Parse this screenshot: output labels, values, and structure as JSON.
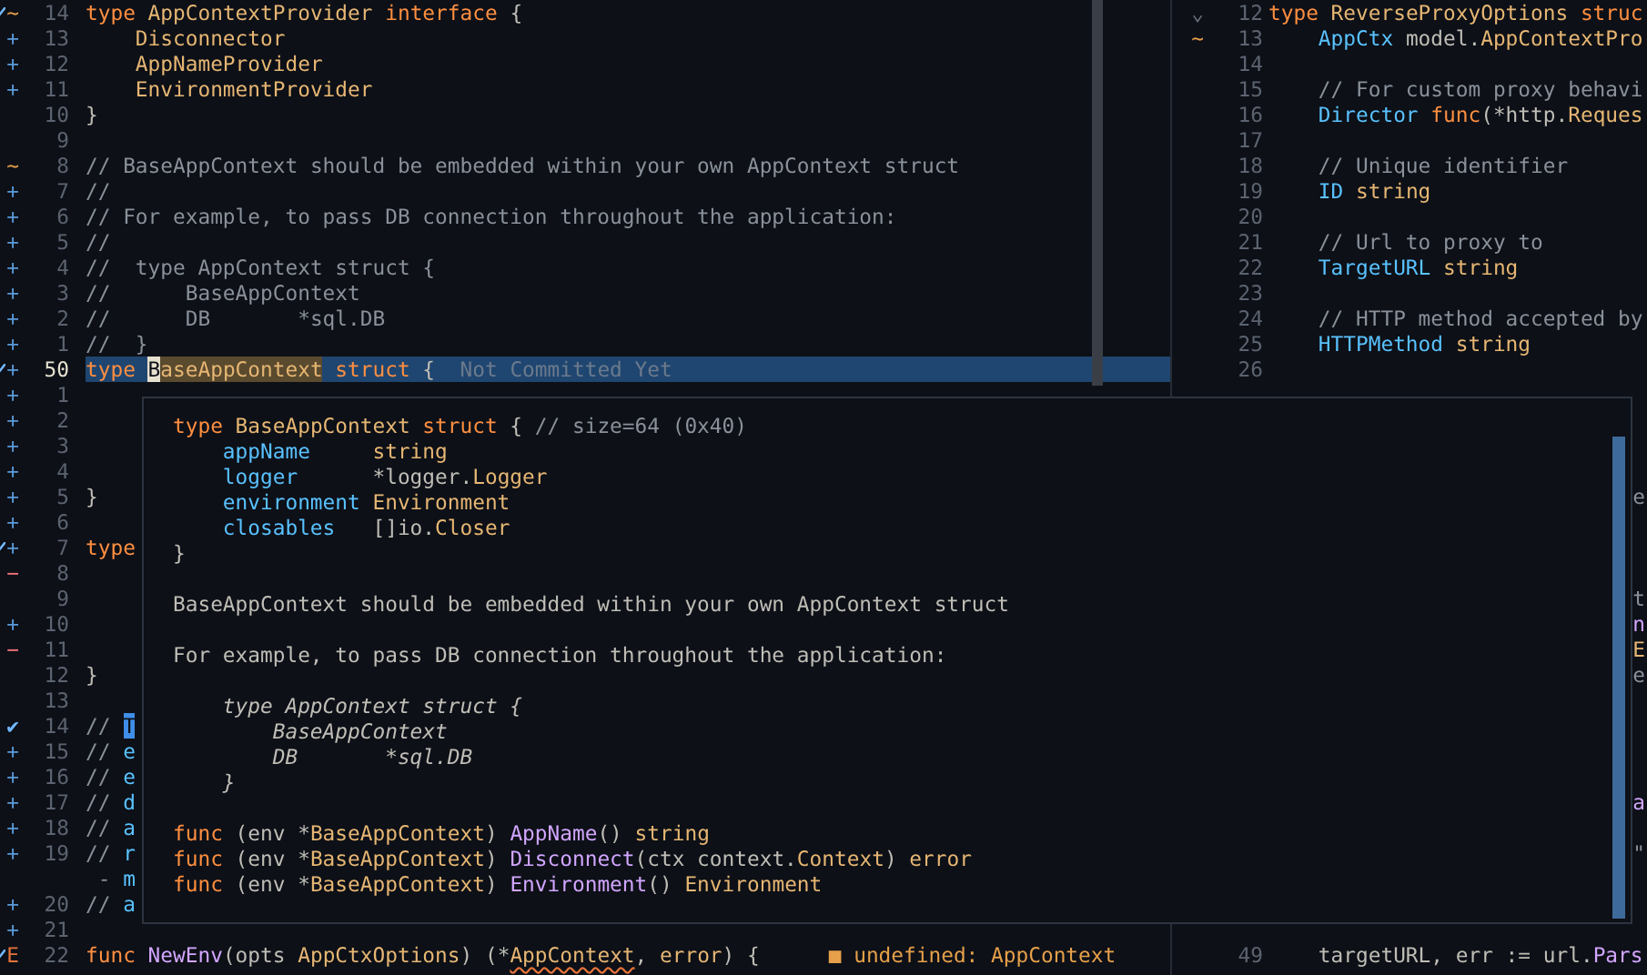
{
  "left_pane": {
    "lines": [
      {
        "sign": {
          "text": "~",
          "kind": "changed"
        },
        "marked": true,
        "number": "14",
        "tokens": [
          {
            "text": "type ",
            "kind": "keyword"
          },
          {
            "text": "AppContextProvider ",
            "kind": "type"
          },
          {
            "text": "interface",
            "kind": "keyword"
          },
          {
            "text": " {",
            "kind": "plain"
          }
        ]
      },
      {
        "sign": {
          "text": "+",
          "kind": "added"
        },
        "number": "13",
        "tokens": [
          {
            "text": "    Disconnector",
            "kind": "type"
          }
        ]
      },
      {
        "sign": {
          "text": "+",
          "kind": "added"
        },
        "number": "12",
        "tokens": [
          {
            "text": "    AppNameProvider",
            "kind": "type"
          }
        ]
      },
      {
        "sign": {
          "text": "+",
          "kind": "added"
        },
        "number": "11",
        "tokens": [
          {
            "text": "    EnvironmentProvider",
            "kind": "type"
          }
        ]
      },
      {
        "number": "10",
        "tokens": [
          {
            "text": "}",
            "kind": "plain"
          }
        ]
      },
      {
        "number": "9"
      },
      {
        "sign": {
          "text": "~",
          "kind": "changed"
        },
        "number": "8",
        "tokens": [
          {
            "text": "// BaseAppContext should be embedded within your own AppContext struct",
            "kind": "comment"
          }
        ]
      },
      {
        "sign": {
          "text": "+",
          "kind": "added"
        },
        "number": "7",
        "tokens": [
          {
            "text": "//",
            "kind": "comment"
          }
        ]
      },
      {
        "sign": {
          "text": "+",
          "kind": "added"
        },
        "number": "6",
        "tokens": [
          {
            "text": "// For example, to pass DB connection throughout the application:",
            "kind": "comment"
          }
        ]
      },
      {
        "sign": {
          "text": "+",
          "kind": "added"
        },
        "number": "5",
        "tokens": [
          {
            "text": "//",
            "kind": "comment"
          }
        ]
      },
      {
        "sign": {
          "text": "+",
          "kind": "added"
        },
        "number": "4",
        "tokens": [
          {
            "text": "//  type AppContext struct {",
            "kind": "comment"
          }
        ]
      },
      {
        "sign": {
          "text": "+",
          "kind": "added"
        },
        "number": "3",
        "tokens": [
          {
            "text": "//      BaseAppContext",
            "kind": "comment"
          }
        ]
      },
      {
        "sign": {
          "text": "+",
          "kind": "added"
        },
        "number": "2",
        "tokens": [
          {
            "text": "//      DB       *sql.DB",
            "kind": "comment"
          }
        ]
      },
      {
        "sign": {
          "text": "+",
          "kind": "added"
        },
        "number": "1",
        "tokens": [
          {
            "text": "//  }",
            "kind": "comment"
          }
        ]
      },
      {
        "sign": {
          "text": "+",
          "kind": "added"
        },
        "marked": true,
        "current": true,
        "number": "50",
        "tokens": [
          {
            "text": "type ",
            "kind": "keyword"
          },
          {
            "text": "B",
            "kind": "cursor"
          },
          {
            "text": "aseAppContext",
            "kind": "reference"
          },
          {
            "text": " struct",
            "kind": "keyword"
          },
          {
            "text": " {",
            "kind": "plain"
          },
          {
            "text": "  Not Committed Yet",
            "kind": "blame"
          }
        ]
      },
      {
        "sign": {
          "text": "+",
          "kind": "added"
        },
        "number": "1"
      },
      {
        "sign": {
          "text": "+",
          "kind": "added"
        },
        "number": "2"
      },
      {
        "sign": {
          "text": "+",
          "kind": "added"
        },
        "number": "3"
      },
      {
        "sign": {
          "text": "+",
          "kind": "added"
        },
        "number": "4"
      },
      {
        "sign": {
          "text": "+",
          "kind": "added"
        },
        "number": "5",
        "tokens": [
          {
            "text": "}",
            "kind": "plain"
          }
        ]
      },
      {
        "sign": {
          "text": "+",
          "kind": "added"
        },
        "number": "6"
      },
      {
        "sign": {
          "text": "+",
          "kind": "added"
        },
        "marked": true,
        "number": "7",
        "tokens": [
          {
            "text": "type",
            "kind": "keyword"
          }
        ]
      },
      {
        "sign": {
          "text": "−",
          "kind": "removed"
        },
        "number": "8"
      },
      {
        "number": "9"
      },
      {
        "sign": {
          "text": "+",
          "kind": "added"
        },
        "number": "10"
      },
      {
        "sign": {
          "text": "−",
          "kind": "removed"
        },
        "number": "11"
      },
      {
        "number": "12",
        "tokens": [
          {
            "text": "}",
            "kind": "plain"
          }
        ]
      },
      {
        "number": "13"
      },
      {
        "sign": {
          "text": "✔",
          "kind": "check"
        },
        "number": "14",
        "tokens": [
          {
            "text": "// ",
            "kind": "comment"
          },
          {
            "text": "T",
            "kind": "selection"
          }
        ]
      },
      {
        "sign": {
          "text": "+",
          "kind": "added"
        },
        "number": "15",
        "tokens": [
          {
            "text": "// ",
            "kind": "comment"
          },
          {
            "text": "e",
            "kind": "doc"
          }
        ]
      },
      {
        "sign": {
          "text": "+",
          "kind": "added"
        },
        "number": "16",
        "tokens": [
          {
            "text": "// ",
            "kind": "comment"
          },
          {
            "text": "e",
            "kind": "doc"
          }
        ]
      },
      {
        "sign": {
          "text": "+",
          "kind": "added"
        },
        "number": "17",
        "tokens": [
          {
            "text": "// ",
            "kind": "comment"
          },
          {
            "text": "d",
            "kind": "doc"
          }
        ]
      },
      {
        "sign": {
          "text": "+",
          "kind": "added"
        },
        "number": "18",
        "tokens": [
          {
            "text": "// ",
            "kind": "comment"
          },
          {
            "text": "a",
            "kind": "doc"
          }
        ]
      },
      {
        "sign": {
          "text": "+",
          "kind": "added"
        },
        "number": "19",
        "tokens": [
          {
            "text": "// ",
            "kind": "comment"
          },
          {
            "text": "r",
            "kind": "doc"
          }
        ]
      },
      {
        "tokens": [
          {
            "text": " - ",
            "kind": "comment"
          },
          {
            "text": "m",
            "kind": "doc"
          }
        ]
      },
      {
        "sign": {
          "text": "+",
          "kind": "added"
        },
        "number": "20",
        "tokens": [
          {
            "text": "// ",
            "kind": "comment"
          },
          {
            "text": "a",
            "kind": "doc"
          }
        ]
      },
      {
        "sign": {
          "text": "+",
          "kind": "added"
        },
        "number": "21"
      },
      {
        "sign": {
          "text": "E",
          "kind": "error"
        },
        "marked": true,
        "number": "22",
        "tokens": [
          {
            "text": "func ",
            "kind": "keyword"
          },
          {
            "text": "NewEnv",
            "kind": "func"
          },
          {
            "text": "(opts ",
            "kind": "plain"
          },
          {
            "text": "AppCtxOptions",
            "kind": "type"
          },
          {
            "text": ") (*",
            "kind": "plain"
          },
          {
            "text": "AppContext",
            "kind": "error"
          },
          {
            "text": ", ",
            "kind": "plain"
          },
          {
            "text": "error",
            "kind": "type"
          },
          {
            "text": ") {",
            "kind": "plain"
          }
        ],
        "diagnostic": "■ undefined: AppContext"
      }
    ]
  },
  "right_pane": {
    "lines": [
      {
        "sign": {
          "text": "⌄",
          "kind": "fold"
        },
        "number": "12",
        "tokens": [
          {
            "text": "type ",
            "kind": "keyword"
          },
          {
            "text": "ReverseProxyOptions ",
            "kind": "type"
          },
          {
            "text": "struc",
            "kind": "keyword"
          }
        ]
      },
      {
        "sign": {
          "text": "~",
          "kind": "changed"
        },
        "number": "13",
        "tokens": [
          {
            "text": "    AppCtx ",
            "kind": "field"
          },
          {
            "text": "model.",
            "kind": "plain"
          },
          {
            "text": "AppContextPro",
            "kind": "type"
          }
        ]
      },
      {
        "number": "14"
      },
      {
        "number": "15",
        "tokens": [
          {
            "text": "    // For custom proxy behavi",
            "kind": "comment"
          }
        ]
      },
      {
        "number": "16",
        "tokens": [
          {
            "text": "    Director ",
            "kind": "field"
          },
          {
            "text": "func",
            "kind": "keyword"
          },
          {
            "text": "(*http.",
            "kind": "plain"
          },
          {
            "text": "Reques",
            "kind": "type"
          }
        ]
      },
      {
        "number": "17"
      },
      {
        "number": "18",
        "tokens": [
          {
            "text": "    // Unique identifier",
            "kind": "comment"
          }
        ]
      },
      {
        "number": "19",
        "tokens": [
          {
            "text": "    ID ",
            "kind": "field"
          },
          {
            "text": "string",
            "kind": "type"
          }
        ]
      },
      {
        "number": "20"
      },
      {
        "number": "21",
        "tokens": [
          {
            "text": "    // Url to proxy to",
            "kind": "comment"
          }
        ]
      },
      {
        "number": "22",
        "tokens": [
          {
            "text": "    TargetURL ",
            "kind": "field"
          },
          {
            "text": "string",
            "kind": "type"
          }
        ]
      },
      {
        "number": "23"
      },
      {
        "number": "24",
        "tokens": [
          {
            "text": "    // HTTP method accepted by",
            "kind": "comment"
          }
        ]
      },
      {
        "number": "25",
        "tokens": [
          {
            "text": "    HTTPMethod ",
            "kind": "field"
          },
          {
            "text": "string",
            "kind": "type"
          }
        ]
      },
      {
        "number": "26"
      },
      {
        "blank": true
      },
      {
        "blank": true
      },
      {
        "blank": true
      },
      {
        "blank": true
      },
      {
        "tokens": [
          {
            "text": "e",
            "kind": "comment"
          }
        ]
      },
      {
        "blank": true
      },
      {
        "blank": true
      },
      {
        "blank": true
      },
      {
        "tokens": [
          {
            "text": "t",
            "kind": "comment"
          }
        ]
      },
      {
        "tokens": [
          {
            "text": "n",
            "kind": "func"
          }
        ]
      },
      {
        "tokens": [
          {
            "text": "E",
            "kind": "type"
          }
        ]
      },
      {
        "tokens": [
          {
            "text": "e",
            "kind": "comment"
          }
        ]
      },
      {
        "blank": true
      },
      {
        "blank": true
      },
      {
        "blank": true
      },
      {
        "blank": true
      },
      {
        "tokens": [
          {
            "text": "a",
            "kind": "func"
          }
        ]
      },
      {
        "blank": true
      },
      {
        "tokens": [
          {
            "text": "\"",
            "kind": "comment"
          }
        ]
      },
      {
        "blank": true
      },
      {
        "blank": true
      },
      {
        "blank": true
      },
      {
        "number": "49",
        "tokens": [
          {
            "text": "    targetURL, err := url.",
            "kind": "plain"
          },
          {
            "text": "Pars",
            "kind": "func"
          }
        ]
      }
    ]
  },
  "hover_popup": {
    "sections": [
      {
        "lines": [
          {
            "tokens": [
              {
                "text": "type ",
                "kind": "keyword"
              },
              {
                "text": "BaseAppContext ",
                "kind": "type"
              },
              {
                "text": "struct",
                "kind": "keyword"
              },
              {
                "text": " { ",
                "kind": "plain"
              },
              {
                "text": "// size=64 (0x40)",
                "kind": "comment"
              }
            ]
          },
          {
            "tokens": [
              {
                "text": "    appName     ",
                "kind": "field"
              },
              {
                "text": "string",
                "kind": "type"
              }
            ]
          },
          {
            "tokens": [
              {
                "text": "    logger      ",
                "kind": "field"
              },
              {
                "text": "*logger.",
                "kind": "plain"
              },
              {
                "text": "Logger",
                "kind": "type"
              }
            ]
          },
          {
            "tokens": [
              {
                "text": "    environment ",
                "kind": "field"
              },
              {
                "text": "Environment",
                "kind": "type"
              }
            ]
          },
          {
            "tokens": [
              {
                "text": "    closables   ",
                "kind": "field"
              },
              {
                "text": "[]io.",
                "kind": "plain"
              },
              {
                "text": "Closer",
                "kind": "type"
              }
            ]
          },
          {
            "tokens": [
              {
                "text": "}",
                "kind": "plain"
              }
            ]
          }
        ]
      },
      {
        "lines": [
          {
            "tokens": [
              {
                "text": "BaseAppContext should be embedded within your own AppContext struct",
                "kind": "plain"
              }
            ]
          }
        ]
      },
      {
        "lines": [
          {
            "tokens": [
              {
                "text": "For example, to pass DB connection throughout the application:",
                "kind": "plain"
              }
            ]
          }
        ]
      },
      {
        "lines": [
          {
            "tokens": [
              {
                "text": "    type AppContext struct {",
                "kind": "italic"
              }
            ]
          },
          {
            "tokens": [
              {
                "text": "        BaseAppContext",
                "kind": "italic"
              }
            ]
          },
          {
            "tokens": [
              {
                "text": "        DB       *sql.DB",
                "kind": "italic"
              }
            ]
          },
          {
            "tokens": [
              {
                "text": "    }",
                "kind": "italic"
              }
            ]
          }
        ]
      },
      {
        "lines": [
          {
            "tokens": [
              {
                "text": "func",
                "kind": "keyword"
              },
              {
                "text": " (env *",
                "kind": "plain"
              },
              {
                "text": "BaseAppContext",
                "kind": "type"
              },
              {
                "text": ") ",
                "kind": "plain"
              },
              {
                "text": "AppName",
                "kind": "func"
              },
              {
                "text": "() ",
                "kind": "plain"
              },
              {
                "text": "string",
                "kind": "type"
              }
            ]
          },
          {
            "tokens": [
              {
                "text": "func",
                "kind": "keyword"
              },
              {
                "text": " (env *",
                "kind": "plain"
              },
              {
                "text": "BaseAppContext",
                "kind": "type"
              },
              {
                "text": ") ",
                "kind": "plain"
              },
              {
                "text": "Disconnect",
                "kind": "func"
              },
              {
                "text": "(ctx context.",
                "kind": "plain"
              },
              {
                "text": "Context",
                "kind": "type"
              },
              {
                "text": ") ",
                "kind": "plain"
              },
              {
                "text": "error",
                "kind": "type"
              }
            ]
          },
          {
            "tokens": [
              {
                "text": "func",
                "kind": "keyword"
              },
              {
                "text": " (env *",
                "kind": "plain"
              },
              {
                "text": "BaseAppContext",
                "kind": "type"
              },
              {
                "text": ") ",
                "kind": "plain"
              },
              {
                "text": "Environment",
                "kind": "func"
              },
              {
                "text": "() ",
                "kind": "plain"
              },
              {
                "text": "Environment",
                "kind": "type"
              }
            ]
          }
        ]
      }
    ]
  }
}
